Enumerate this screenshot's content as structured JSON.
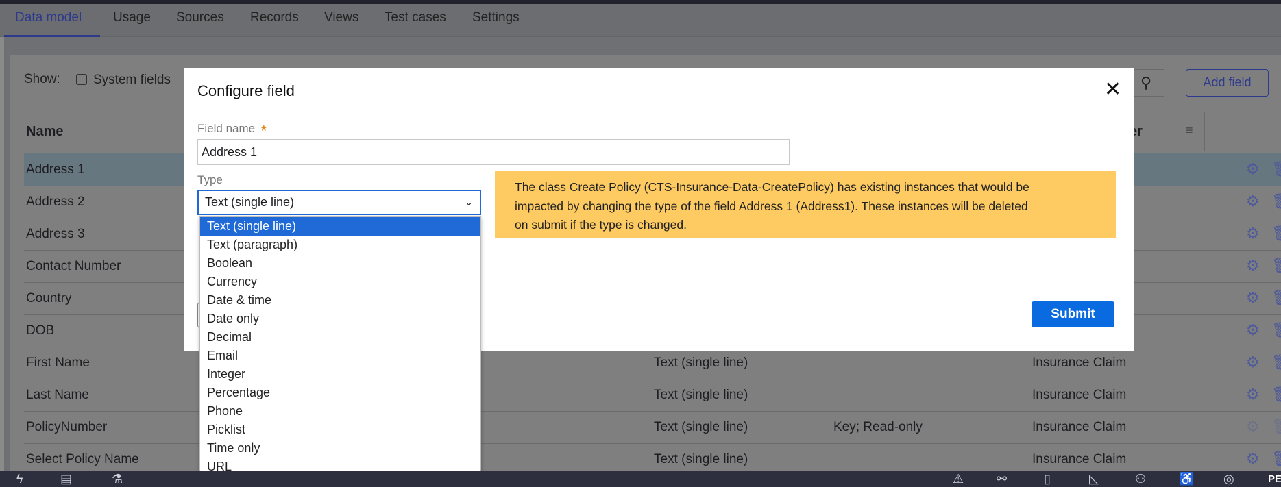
{
  "tabs": [
    "Data model",
    "Usage",
    "Sources",
    "Records",
    "Views",
    "Test cases",
    "Settings"
  ],
  "toolbar": {
    "show_label": "Show:",
    "system_fields_label": "System fields",
    "add_field_label": "Add field"
  },
  "table": {
    "headers": {
      "name": "Name",
      "class_partial": "er"
    },
    "rows": [
      {
        "name": "Address 1",
        "type": "",
        "options": "",
        "class": ""
      },
      {
        "name": "Address 2",
        "type": "",
        "options": "",
        "class": ""
      },
      {
        "name": "Address 3",
        "type": "",
        "options": "",
        "class": ""
      },
      {
        "name": "Contact Number",
        "type": "",
        "options": "",
        "class": ""
      },
      {
        "name": "Country",
        "type": "",
        "options": "",
        "class": ""
      },
      {
        "name": "DOB",
        "type": "",
        "options": "",
        "class": ""
      },
      {
        "name": "First Name",
        "type": "Text (single line)",
        "options": "",
        "class": "Insurance Claim"
      },
      {
        "name": "Last Name",
        "type": "Text (single line)",
        "options": "",
        "class": "Insurance Claim"
      },
      {
        "name": "PolicyNumber",
        "type": "Text (single line)",
        "options": "Key; Read-only",
        "class": "Insurance Claim"
      },
      {
        "name": "Select Policy Name",
        "type": "Text (single line)",
        "options": "",
        "class": "Insurance Claim"
      }
    ]
  },
  "modal": {
    "title": "Configure field",
    "field_name_label": "Field name",
    "required_marker": "★",
    "field_name_value": "Address 1",
    "type_label": "Type",
    "type_value": "Text (single line)",
    "type_options": [
      "Text (single line)",
      "Text (paragraph)",
      "Boolean",
      "Currency",
      "Date & time",
      "Date only",
      "Decimal",
      "Email",
      "Integer",
      "Percentage",
      "Phone",
      "Picklist",
      "Time only",
      "URL"
    ],
    "warning_lines": [
      "The class Create Policy (CTS-Insurance-Data-CreatePolicy) has existing instances that would be",
      "impacted by changing the type of the field Address 1 (Address1). These instances will be deleted",
      "on submit if the type is changed."
    ],
    "submit_label": "Submit"
  },
  "bottombar": {
    "right_text": "PE"
  },
  "colors": {
    "accent": "#1f6ad6",
    "submit": "#0a6be0",
    "warning": "#fecb62",
    "bottombar": "#2d2f3f"
  }
}
